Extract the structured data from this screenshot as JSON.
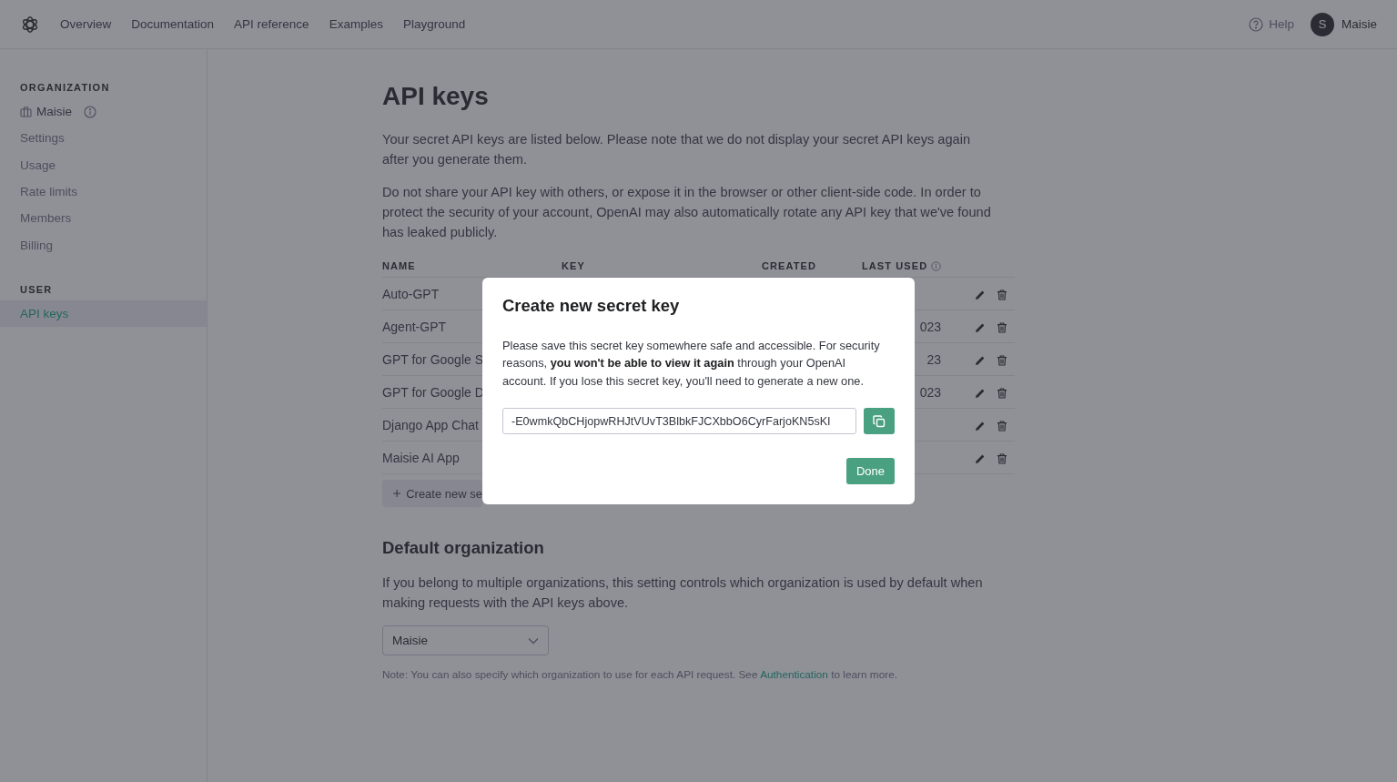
{
  "nav": {
    "links": [
      "Overview",
      "Documentation",
      "API reference",
      "Examples",
      "Playground"
    ],
    "help": "Help",
    "user_initial": "S",
    "user_name": "Maisie"
  },
  "sidebar": {
    "sections": [
      {
        "heading": "ORGANIZATION",
        "items": [
          {
            "label": "Maisie",
            "kind": "org",
            "selected": false
          },
          {
            "label": "Settings",
            "kind": "link",
            "selected": false
          },
          {
            "label": "Usage",
            "kind": "link",
            "selected": false
          },
          {
            "label": "Rate limits",
            "kind": "link",
            "selected": false
          },
          {
            "label": "Members",
            "kind": "link",
            "selected": false
          },
          {
            "label": "Billing",
            "kind": "link",
            "selected": false
          }
        ]
      },
      {
        "heading": "USER",
        "items": [
          {
            "label": "API keys",
            "kind": "link",
            "selected": true
          }
        ]
      }
    ]
  },
  "page": {
    "title": "API keys",
    "paragraphs": [
      "Your secret API keys are listed below. Please note that we do not display your secret API keys again after you generate them.",
      "Do not share your API key with others, or expose it in the browser or other client-side code. In order to protect the security of your account, OpenAI may also automatically rotate any API key that we've found has leaked publicly."
    ],
    "table": {
      "columns": [
        {
          "label": "NAME",
          "kind": "plain"
        },
        {
          "label": "KEY",
          "kind": "plain"
        },
        {
          "label": "CREATED",
          "kind": "plain"
        },
        {
          "label": "LAST USED",
          "kind": "info"
        }
      ],
      "rows": [
        {
          "name": "Auto-GPT"
        },
        {
          "name": "Agent-GPT",
          "last_used": "023"
        },
        {
          "name": "GPT for Google S",
          "last_used": "23"
        },
        {
          "name": "GPT for Google D",
          "last_used": "023"
        },
        {
          "name": "Django App Chat"
        },
        {
          "name": "Maisie AI App"
        }
      ]
    },
    "create_button": "Create new se",
    "default_org": {
      "title": "Default organization",
      "text": "If you belong to multiple organizations, this setting controls which organization is used by default when making requests with the API keys above.",
      "select_value": "Maisie",
      "note_before": "Note: You can also specify which organization to use for each API request. See ",
      "note_link": "Authentication",
      "note_after": " to learn more."
    }
  },
  "dialog": {
    "title": "Create new secret key",
    "text": "Please save this secret key somewhere safe and accessible. For security reasons, **you won't be able to view it again** through your OpenAI account. If you lose this secret key, you'll need to generate a new one.",
    "key": "-E0wmkQbCHjopwRHJtVUvT3BlbkFJCXbbO6CyrFarjoKN5sKI",
    "done": "Done"
  }
}
